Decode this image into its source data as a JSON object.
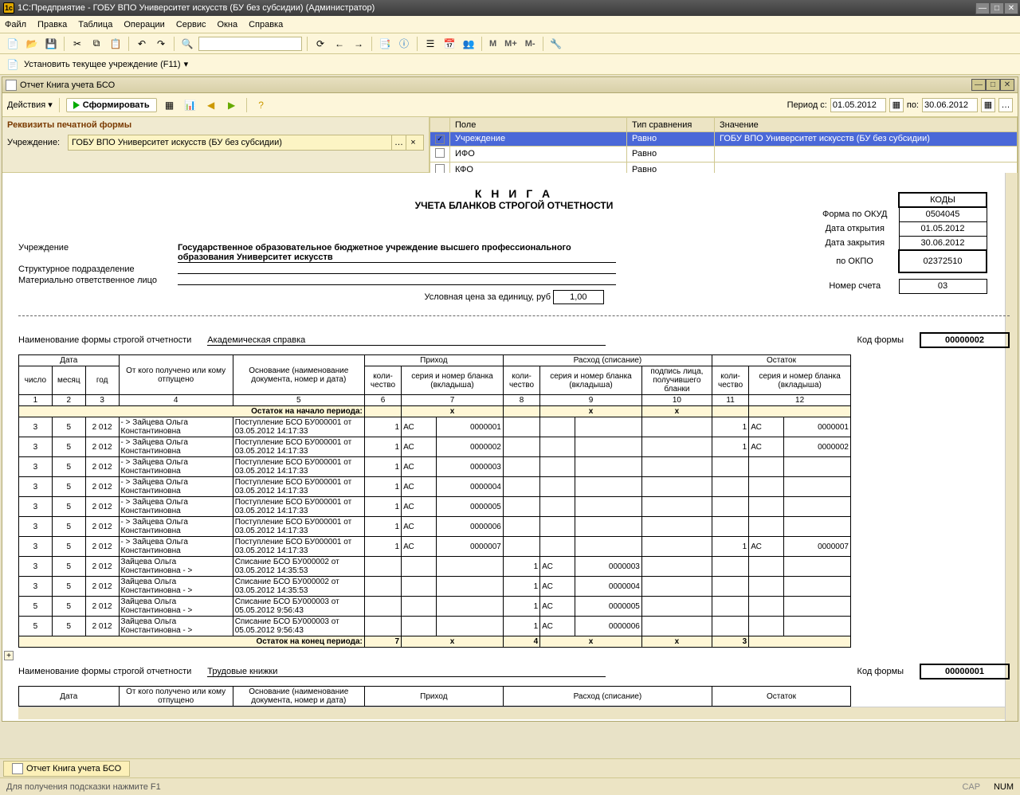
{
  "app_title": "1C:Предприятие - ГОБУ ВПО Университет искусств (БУ без субсидии) (Администратор)",
  "menu": {
    "file": "Файл",
    "edit": "Правка",
    "table": "Таблица",
    "ops": "Операции",
    "service": "Сервис",
    "windows": "Окна",
    "help": "Справка"
  },
  "toolbar2": {
    "set_inst": "Установить текущее учреждение (F11)"
  },
  "subwin": {
    "title": "Отчет  Книга учета БСО"
  },
  "subtool": {
    "actions": "Действия",
    "form": "Сформировать",
    "period_label": "Период с:",
    "period_to": "по:",
    "date_from": "01.05.2012",
    "date_to": "30.06.2012"
  },
  "filters": {
    "header": "Реквизиты печатной формы",
    "inst_label": "Учреждение:",
    "inst_value": "ГОБУ ВПО Университет искусств (БУ без субсидии)",
    "cols": {
      "field": "Поле",
      "comp": "Тип сравнения",
      "val": "Значение"
    },
    "rows": [
      {
        "checked": true,
        "field": "Учреждение",
        "comp": "Равно",
        "val": "ГОБУ ВПО Университет искусств (БУ без субсидии)",
        "sel": true
      },
      {
        "checked": false,
        "field": "ИФО",
        "comp": "Равно",
        "val": ""
      },
      {
        "checked": false,
        "field": "КФО",
        "comp": "Равно",
        "val": ""
      }
    ]
  },
  "report": {
    "title": "К Н И Г А",
    "subtitle": "УЧЕТА БЛАНКОВ СТРОГОЙ ОТЧЕТНОСТИ",
    "kody": "КОДЫ",
    "okud_label": "Форма по ОКУД",
    "okud": "0504045",
    "open_label": "Дата открытия",
    "open": "01.05.2012",
    "close_label": "Дата закрытия",
    "close": "30.06.2012",
    "okpo_label": "по ОКПО",
    "okpo": "02372510",
    "account_label": "Номер счета",
    "account": "03",
    "inst_label": "Учреждение",
    "inst": "Государственное образовательное бюджетное учреждение высшего профессионального образования  Университет искусств",
    "dept_label": "Структурное подразделение",
    "mol_label": "Материально ответственное лицо",
    "price_label": "Условная цена за единицу, руб",
    "price": "1,00",
    "formname_label": "Наименование формы строгой отчетности",
    "formname": "Академическая справка",
    "formcode_label": "Код формы",
    "formcode": "00000002",
    "formname2": "Трудовые книжки",
    "formcode2": "00000001"
  },
  "headers": {
    "date": "Дата",
    "from": "От кого получено или кому отпущено",
    "basis": "Основание (наименование документа, номер и дата)",
    "income": "Приход",
    "expense": "Расход (списание)",
    "remain": "Остаток",
    "qty": "коли-\nчество",
    "series": "серия и номер бланка (вкладыша)",
    "sign": "подпись лица, получившего бланки",
    "day": "число",
    "mon": "месяц",
    "year": "год",
    "n1": "1",
    "n2": "2",
    "n3": "3",
    "n4": "4",
    "n5": "5",
    "n6": "6",
    "n7": "7",
    "n8": "8",
    "n9": "9",
    "n10": "10",
    "n11": "11",
    "n12": "12",
    "period_start": "Остаток на начало периода:",
    "period_end": "Остаток на конец периода:"
  },
  "rows": [
    {
      "d": "3",
      "m": "5",
      "y": "2 012",
      "who": "- > Зайцева Ольга Константиновна",
      "doc": "Поступление БСО БУ000001 от 03.05.2012 14:17:33",
      "iq": "1",
      "is": "АС",
      "in": "0000001",
      "eq": "",
      "es": "",
      "en": "",
      "sig": "",
      "rq": "1",
      "rs": "АС",
      "rn": "0000001"
    },
    {
      "d": "3",
      "m": "5",
      "y": "2 012",
      "who": "- > Зайцева Ольга Константиновна",
      "doc": "Поступление БСО БУ000001 от 03.05.2012 14:17:33",
      "iq": "1",
      "is": "АС",
      "in": "0000002",
      "eq": "",
      "es": "",
      "en": "",
      "sig": "",
      "rq": "1",
      "rs": "АС",
      "rn": "0000002"
    },
    {
      "d": "3",
      "m": "5",
      "y": "2 012",
      "who": "- > Зайцева Ольга Константиновна",
      "doc": "Поступление БСО БУ000001 от 03.05.2012 14:17:33",
      "iq": "1",
      "is": "АС",
      "in": "0000003",
      "eq": "",
      "es": "",
      "en": "",
      "sig": "",
      "rq": "",
      "rs": "",
      "rn": ""
    },
    {
      "d": "3",
      "m": "5",
      "y": "2 012",
      "who": "- > Зайцева Ольга Константиновна",
      "doc": "Поступление БСО БУ000001 от 03.05.2012 14:17:33",
      "iq": "1",
      "is": "АС",
      "in": "0000004",
      "eq": "",
      "es": "",
      "en": "",
      "sig": "",
      "rq": "",
      "rs": "",
      "rn": ""
    },
    {
      "d": "3",
      "m": "5",
      "y": "2 012",
      "who": "- > Зайцева Ольга Константиновна",
      "doc": "Поступление БСО БУ000001 от 03.05.2012 14:17:33",
      "iq": "1",
      "is": "АС",
      "in": "0000005",
      "eq": "",
      "es": "",
      "en": "",
      "sig": "",
      "rq": "",
      "rs": "",
      "rn": ""
    },
    {
      "d": "3",
      "m": "5",
      "y": "2 012",
      "who": "- > Зайцева Ольга Константиновна",
      "doc": "Поступление БСО БУ000001 от 03.05.2012 14:17:33",
      "iq": "1",
      "is": "АС",
      "in": "0000006",
      "eq": "",
      "es": "",
      "en": "",
      "sig": "",
      "rq": "",
      "rs": "",
      "rn": ""
    },
    {
      "d": "3",
      "m": "5",
      "y": "2 012",
      "who": "- > Зайцева Ольга Константиновна",
      "doc": "Поступление БСО БУ000001 от 03.05.2012 14:17:33",
      "iq": "1",
      "is": "АС",
      "in": "0000007",
      "eq": "",
      "es": "",
      "en": "",
      "sig": "",
      "rq": "1",
      "rs": "АС",
      "rn": "0000007"
    },
    {
      "d": "3",
      "m": "5",
      "y": "2 012",
      "who": "Зайцева Ольга Константиновна - >",
      "doc": "Списание БСО БУ000002 от 03.05.2012 14:35:53",
      "iq": "",
      "is": "",
      "in": "",
      "eq": "1",
      "es": "АС",
      "en": "0000003",
      "sig": "",
      "rq": "",
      "rs": "",
      "rn": ""
    },
    {
      "d": "3",
      "m": "5",
      "y": "2 012",
      "who": "Зайцева Ольга Константиновна - >",
      "doc": "Списание БСО БУ000002 от 03.05.2012 14:35:53",
      "iq": "",
      "is": "",
      "in": "",
      "eq": "1",
      "es": "АС",
      "en": "0000004",
      "sig": "",
      "rq": "",
      "rs": "",
      "rn": ""
    },
    {
      "d": "5",
      "m": "5",
      "y": "2 012",
      "who": "Зайцева Ольга Константиновна - >",
      "doc": "Списание БСО БУ000003 от 05.05.2012 9:56:43",
      "iq": "",
      "is": "",
      "in": "",
      "eq": "1",
      "es": "АС",
      "en": "0000005",
      "sig": "",
      "rq": "",
      "rs": "",
      "rn": ""
    },
    {
      "d": "5",
      "m": "5",
      "y": "2 012",
      "who": "Зайцева Ольга Константиновна - >",
      "doc": "Списание БСО БУ000003 от 05.05.2012 9:56:43",
      "iq": "",
      "is": "",
      "in": "",
      "eq": "1",
      "es": "АС",
      "en": "0000006",
      "sig": "",
      "rq": "",
      "rs": "",
      "rn": ""
    }
  ],
  "period_end_vals": {
    "iq": "7",
    "eq": "4",
    "rq": "3",
    "x": "x"
  },
  "task_tab": "Отчет Книга учета БСО",
  "status": "Для получения подсказки нажмите F1",
  "status_right": {
    "cap": "CAP",
    "num": "NUM"
  }
}
